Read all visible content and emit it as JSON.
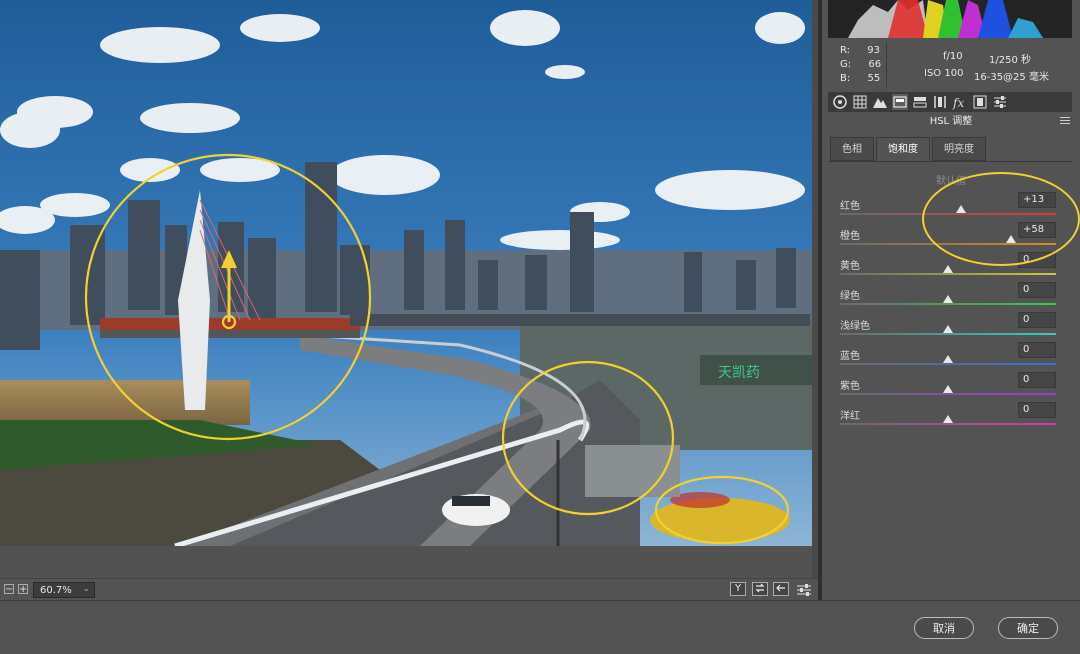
{
  "readout": {
    "r_label": "R:",
    "r": "93",
    "g_label": "G:",
    "g": "66",
    "b_label": "B:",
    "b": "55"
  },
  "camera": {
    "aperture": "f/10",
    "shutter": "1/250 秒",
    "iso": "ISO 100",
    "lens": "16-35@25 毫米"
  },
  "toolbar": [
    "aperture-icon",
    "grid-icon",
    "mountain-icon",
    "hsl-icon",
    "split-tone-icon",
    "lens-icon",
    "fx-icon",
    "camera-calibration-icon",
    "presets-icon"
  ],
  "panel_title": "HSL 调整",
  "tabs": {
    "hue": "色相",
    "saturation": "饱和度",
    "luminance": "明亮度"
  },
  "default_link": "默认值",
  "sliders": [
    {
      "label": "红色",
      "value": "+13",
      "pos": 0.56,
      "color": "#d23a3a"
    },
    {
      "label": "橙色",
      "value": "+58",
      "pos": 0.79,
      "color": "#d98a2a"
    },
    {
      "label": "黄色",
      "value": "0",
      "pos": 0.5,
      "color": "#c9c93a"
    },
    {
      "label": "绿色",
      "value": "0",
      "pos": 0.5,
      "color": "#3ec94a"
    },
    {
      "label": "浅绿色",
      "value": "0",
      "pos": 0.5,
      "color": "#3ac9c0"
    },
    {
      "label": "蓝色",
      "value": "0",
      "pos": 0.5,
      "color": "#3a6ed2"
    },
    {
      "label": "紫色",
      "value": "0",
      "pos": 0.5,
      "color": "#9a3ad2"
    },
    {
      "label": "洋红",
      "value": "0",
      "pos": 0.5,
      "color": "#d23aa8"
    }
  ],
  "zoom": {
    "value": "60.7%",
    "minus": "−",
    "plus": "+"
  },
  "view_buttons": {
    "y": "Y"
  },
  "buttons": {
    "cancel": "取消",
    "ok": "确定"
  },
  "photo": {
    "sign_text": "天凯药"
  }
}
